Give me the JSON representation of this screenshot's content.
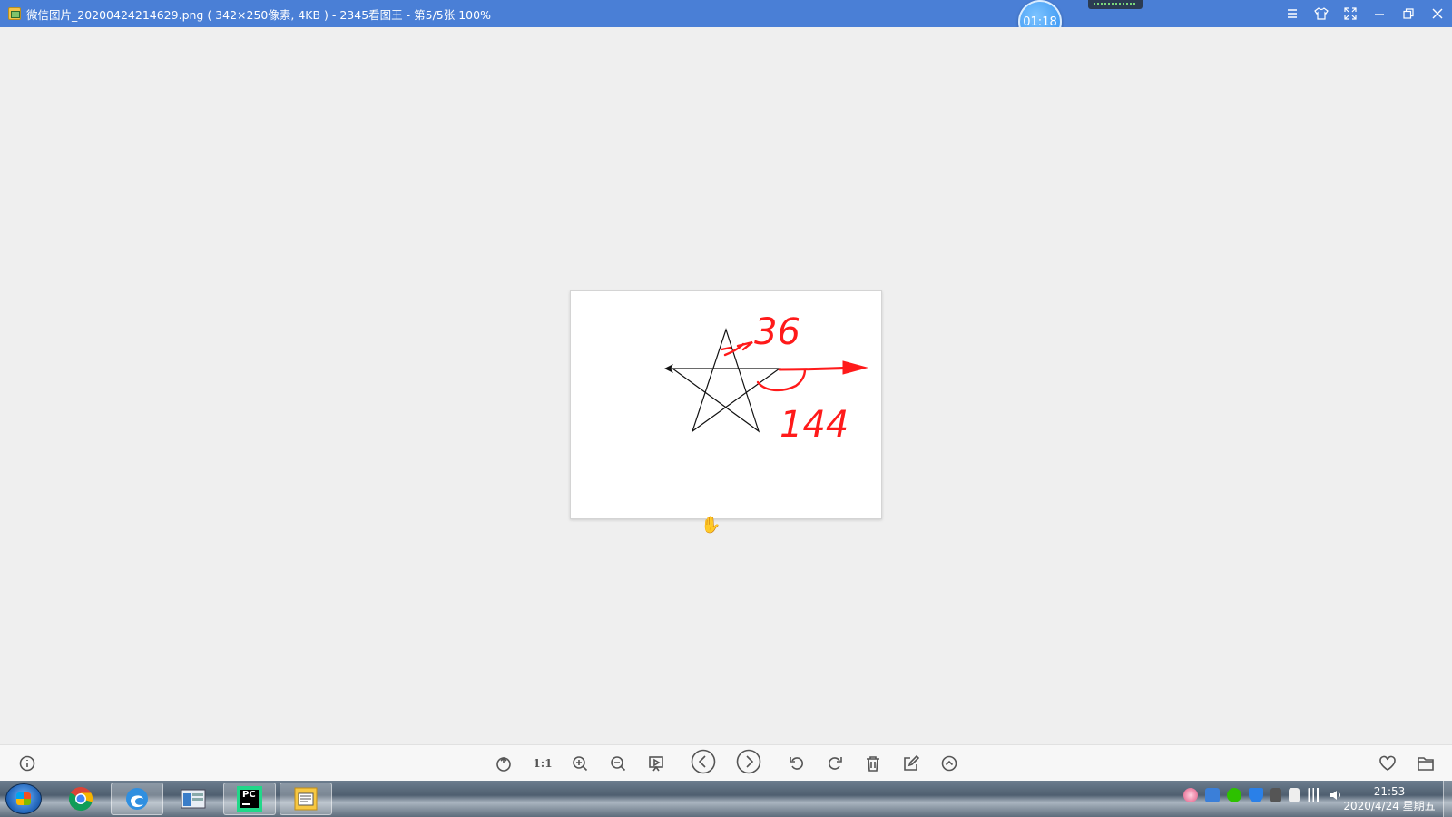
{
  "window": {
    "title": "微信图片_20200424214629.png ( 342×250像素, 4KB ) - 2345看图王 - 第5/5张 100%",
    "timer": "01:18"
  },
  "title_controls": {
    "menu_icon": "menu-icon",
    "skin_icon": "shirt-icon",
    "fullscreen_icon": "fullscreen-icon",
    "minimize_icon": "minimize-icon",
    "restore_icon": "restore-icon",
    "close_icon": "close-icon"
  },
  "image": {
    "annotations": {
      "angle_top": "36",
      "angle_bottom": "144"
    },
    "colors": {
      "ink": "#111111",
      "annotation": "#ff1a1a"
    }
  },
  "toolbar": {
    "actual_size_label": "1:1",
    "icons": [
      "info-icon",
      "fit-icon",
      "actual-size-icon",
      "zoom-in-icon",
      "zoom-out-icon",
      "slideshow-icon",
      "prev-icon",
      "next-icon",
      "rotate-left-icon",
      "rotate-right-icon",
      "delete-icon",
      "edit-icon",
      "more-icon",
      "favorite-icon",
      "open-folder-icon"
    ]
  },
  "taskbar": {
    "apps": [
      "chrome",
      "edge",
      "file-manager",
      "pycharm",
      "image-viewer"
    ],
    "pycharm_label": "PC",
    "clock_time": "21:53",
    "clock_date": "2020/4/24 星期五"
  },
  "accent": {
    "titlebar": "#4a7fd6"
  }
}
